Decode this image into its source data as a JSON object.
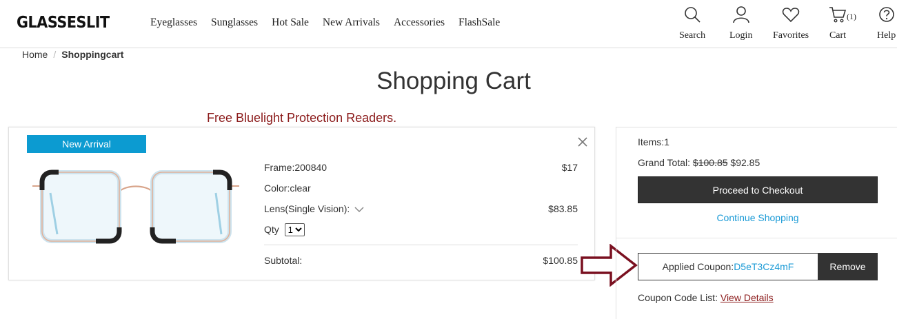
{
  "header": {
    "logo": "GLASSESLIT",
    "nav": [
      "Eyeglasses",
      "Sunglasses",
      "Hot Sale",
      "New Arrivals",
      "Accessories",
      "FlashSale"
    ],
    "actions": {
      "search": "Search",
      "login": "Login",
      "favorites": "Favorites",
      "cart": "Cart",
      "cart_count": "(1)",
      "help": "Help"
    }
  },
  "breadcrumb": {
    "home": "Home",
    "separator": "/",
    "current": "Shoppingcart"
  },
  "page_title": "Shopping Cart",
  "promo": "Free Bluelight Protection Readers.",
  "item": {
    "badge": "New Arrival",
    "frame_label": "Frame:200840",
    "frame_price": "$17",
    "color_label": "Color:clear",
    "lens_label": "Lens(Single Vision):",
    "lens_price": "$83.85",
    "qty_label": "Qty",
    "qty_value": "1",
    "subtotal_label": "Subtotal:",
    "subtotal_value": "$100.85"
  },
  "summary": {
    "items": "Items:1",
    "grand_total_label": "Grand Total:",
    "grand_total_old": "$100.85",
    "grand_total_new": "$92.85",
    "checkout": "Proceed to Checkout",
    "continue": "Continue Shopping",
    "applied_coupon_label": "Applied Coupon:",
    "applied_coupon_code": "D5eT3Cz4mF",
    "remove": "Remove",
    "coupon_list_label": "Coupon Code List:",
    "view_details": "View Details"
  },
  "colors": {
    "accent_blue": "#0c9bd1",
    "link_blue": "#1a9ad6",
    "dark": "#333333",
    "promo_red": "#8b1a1a"
  },
  "icons": [
    "search-icon",
    "user-icon",
    "heart-icon",
    "cart-icon",
    "help-icon",
    "close-icon",
    "chevron-down-icon",
    "arrow-right-icon"
  ]
}
